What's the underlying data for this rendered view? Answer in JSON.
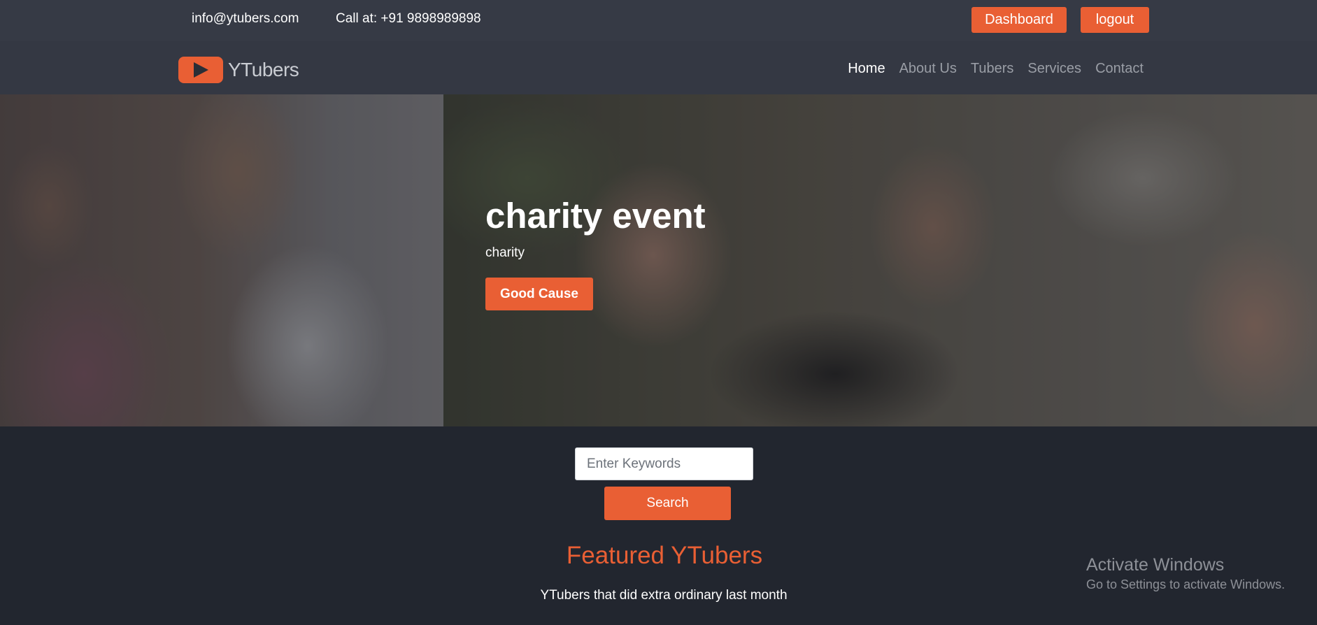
{
  "topbar": {
    "email": "info@ytubers.com",
    "phone": "Call at: +91 9898989898",
    "dashboard_label": "Dashboard",
    "logout_label": "logout"
  },
  "navbar": {
    "logo_text": "YTubers",
    "links": [
      {
        "label": "Home",
        "active": true
      },
      {
        "label": "About Us"
      },
      {
        "label": "Tubers"
      },
      {
        "label": "Services"
      },
      {
        "label": "Contact"
      }
    ]
  },
  "hero": {
    "title": "charity event",
    "subtitle": "charity",
    "button_label": "Good Cause"
  },
  "search": {
    "placeholder": "Enter Keywords",
    "button_label": "Search"
  },
  "featured": {
    "title": "Featured YTubers",
    "subtitle": "YTubers that did extra ordinary last month"
  },
  "watermark": {
    "title": "Activate Windows",
    "subtitle": "Go to Settings to activate Windows."
  },
  "colors": {
    "accent": "#e95f34",
    "topbar_bg": "#363a45",
    "navbar_bg": "#343843",
    "page_bg": "#22262f"
  },
  "icons": {
    "logo": "play-icon"
  }
}
